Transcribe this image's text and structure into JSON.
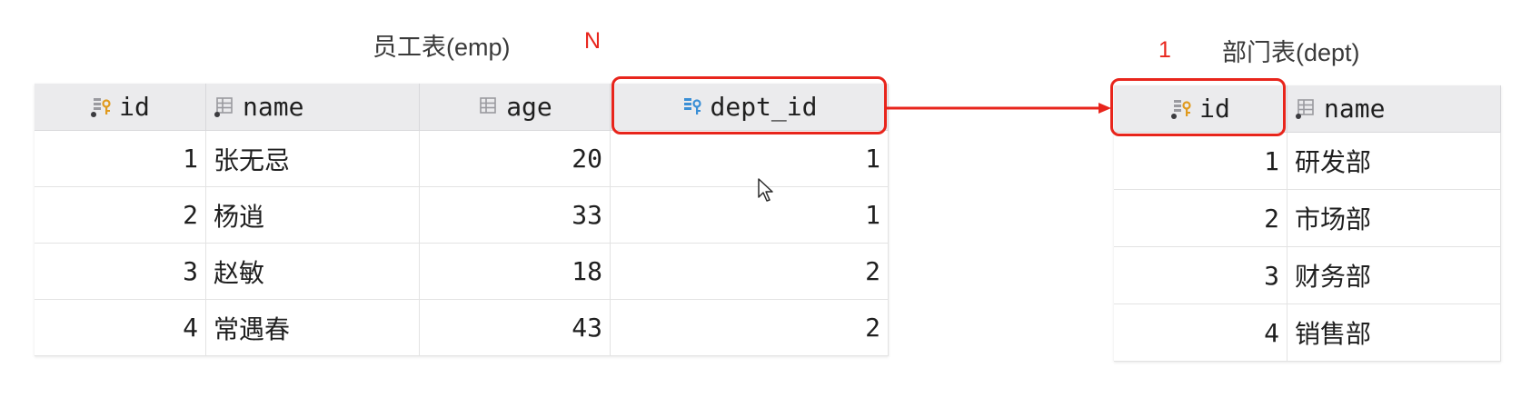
{
  "emp_table": {
    "title": "员工表(emp)",
    "cardinality": "N",
    "columns": [
      {
        "label": "id",
        "icon": "primary-key-column-icon"
      },
      {
        "label": "name",
        "icon": "column-icon"
      },
      {
        "label": "age",
        "icon": "column-icon"
      },
      {
        "label": "dept_id",
        "icon": "foreign-key-column-icon"
      }
    ],
    "rows": [
      [
        "1",
        "张无忌",
        "20",
        "1"
      ],
      [
        "2",
        "杨逍",
        "33",
        "1"
      ],
      [
        "3",
        "赵敏",
        "18",
        "2"
      ],
      [
        "4",
        "常遇春",
        "43",
        "2"
      ]
    ]
  },
  "dept_table": {
    "title": "部门表(dept)",
    "cardinality": "1",
    "columns": [
      {
        "label": "id",
        "icon": "primary-key-column-icon"
      },
      {
        "label": "name",
        "icon": "column-icon"
      }
    ],
    "rows": [
      [
        "1",
        "研发部"
      ],
      [
        "2",
        "市场部"
      ],
      [
        "3",
        "财务部"
      ],
      [
        "4",
        "销售部"
      ]
    ]
  },
  "colors": {
    "highlight": "#e8251c",
    "header_bg": "#ebebed",
    "pk_key": "#e09a1e",
    "fk_key": "#3a8fd6"
  },
  "annotations": {
    "relation": "dept_id-to-id-arrow",
    "pointer": "mouse-cursor-icon"
  }
}
